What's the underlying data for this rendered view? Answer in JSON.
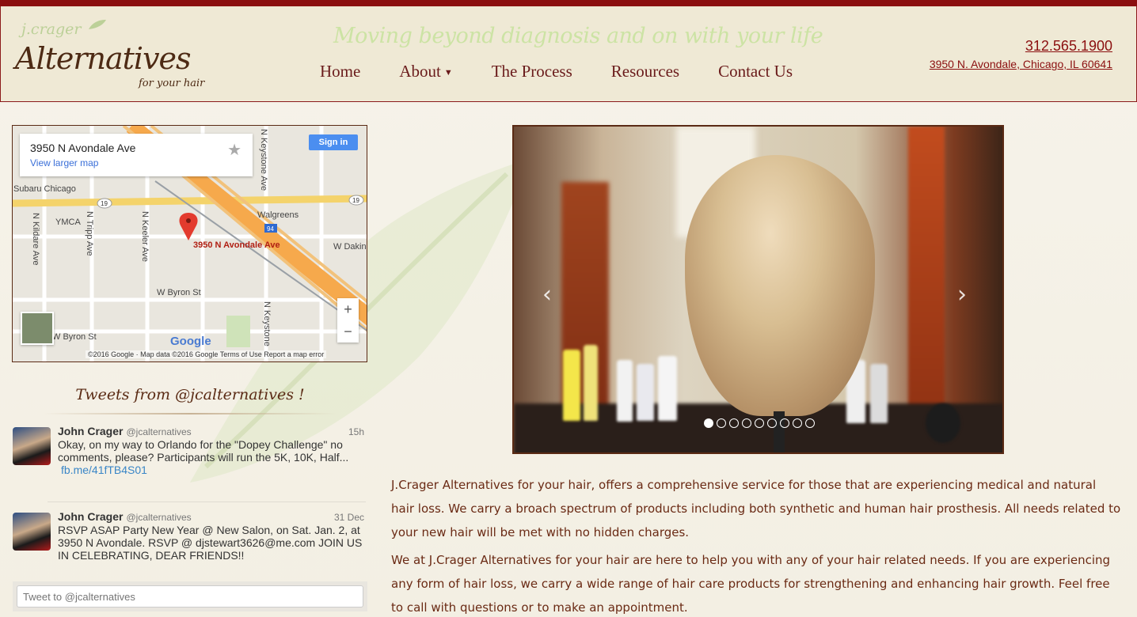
{
  "header": {
    "logo_small": "j.crager",
    "logo_big": "Alternatives",
    "logo_tag": "for your hair",
    "tagline": "Moving beyond diagnosis and on with your life",
    "phone": "312.565.1900",
    "address": "3950 N. Avondale, Chicago, IL 60641"
  },
  "nav": {
    "items": [
      {
        "label": "Home"
      },
      {
        "label": "About"
      },
      {
        "label": "The Process"
      },
      {
        "label": "Resources"
      },
      {
        "label": "Contact Us"
      }
    ]
  },
  "map": {
    "card_address": "3950 N Avondale Ave",
    "card_link": "View larger map",
    "sign_in": "Sign in",
    "pin_label": "3950 N Avondale Ave",
    "labels": {
      "subaru": "Subaru Chicago",
      "ymca": "YMCA",
      "walgreens": "Walgreens",
      "kildare": "N Kildare Ave",
      "tripp": "N Tripp Ave",
      "keeler": "N Keeler Ave",
      "keystone_top": "N Keystone Ave",
      "keystone_bot": "N Keystone",
      "byron_left": "W Byron St",
      "byron_mid": "W Byron St",
      "dakin": "W Dakin",
      "hwy19a": "19",
      "hwy19b": "19",
      "hwy94": "94"
    },
    "google": "Google",
    "footer": "©2016 Google · Map data ©2016 Google    Terms of Use    Report a map error",
    "zoom_in": "+",
    "zoom_out": "−"
  },
  "tweets": {
    "title": "Tweets from @jcalternatives !",
    "items": [
      {
        "name": "John Crager",
        "handle": "@jcalternatives",
        "time": "15h",
        "text": "Okay, on my way to Orlando for the \"Dopey Challenge\" no comments, please? Participants will run the 5K, 10K, Half...",
        "link": "fb.me/41fTB4S01"
      },
      {
        "name": "John Crager",
        "handle": "@jcalternatives",
        "time": "31 Dec",
        "text": "RSVP ASAP Party New Year @ New Salon, on Sat. Jan. 2, at 3950 N Avondale. RSVP @ djstewart3626@me.com JOIN US IN CELEBRATING, DEAR FRIENDS!!",
        "link": ""
      }
    ],
    "compose_placeholder": "Tweet to @jcalternatives"
  },
  "carousel": {
    "prev": "‹",
    "next": "›",
    "slide_count": 9,
    "active_index": 0
  },
  "description": {
    "p1": "J.Crager Alternatives for your hair, offers a comprehensive service for those that are experiencing medical and natural hair loss. We carry a broach spectrum of products including both synthetic and human hair prosthesis. All needs related to your new hair will be met with no hidden charges.",
    "p2": "We at J.Crager Alternatives for your hair are here to help you with any of your hair related needs. If you are experiencing any form of hair loss, we carry a wide range of hair care products for strengthening and enhancing hair growth. Feel free to call with questions or to make an appointment."
  },
  "colors": {
    "brand_red": "#8b0f0f",
    "brand_brown": "#5a2a14",
    "leaf_green": "#cce3a4"
  }
}
